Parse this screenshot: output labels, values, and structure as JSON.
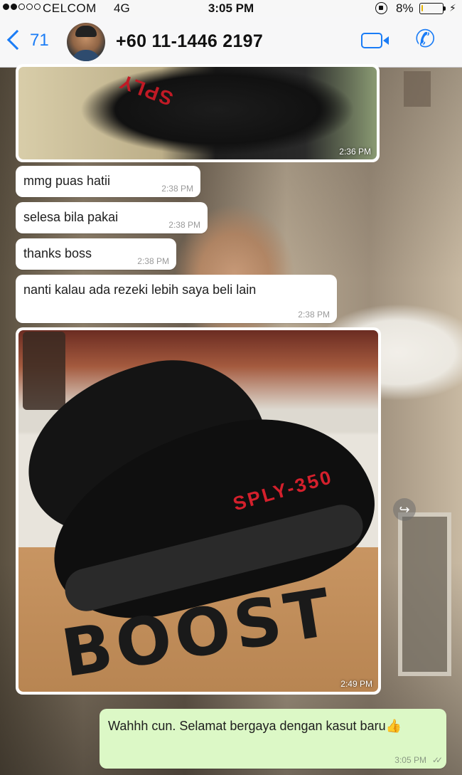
{
  "status_bar": {
    "carrier": "CELCOM",
    "network": "4G",
    "time": "3:05 PM",
    "battery": "8%",
    "battery_level": 0.08
  },
  "header": {
    "back_count": "71",
    "contact_name": "+60 11-1446 2197"
  },
  "messages": [
    {
      "type": "image",
      "time": "2:36 PM",
      "caption_text": "SPLY"
    },
    {
      "type": "text",
      "text": "mmg puas hatii",
      "time": "2:38 PM"
    },
    {
      "type": "text",
      "text": "selesa bila pakai",
      "time": "2:38 PM"
    },
    {
      "type": "text",
      "text": "thanks boss",
      "time": "2:38 PM"
    },
    {
      "type": "text",
      "text": "nanti kalau ada rezeki lebih saya beli lain",
      "time": "2:38 PM"
    },
    {
      "type": "image",
      "time": "2:49 PM",
      "shoe_text": "SPLY-350",
      "box_text": "BOOST"
    }
  ],
  "outgoing": {
    "text": "Wahhh cun. Selamat bergaya dengan kasut baru👍",
    "time": "3:05 PM"
  },
  "colors": {
    "accent": "#1a7cf6",
    "outgoing_bubble": "#dcf8c6",
    "incoming_bubble": "#ffffff"
  }
}
